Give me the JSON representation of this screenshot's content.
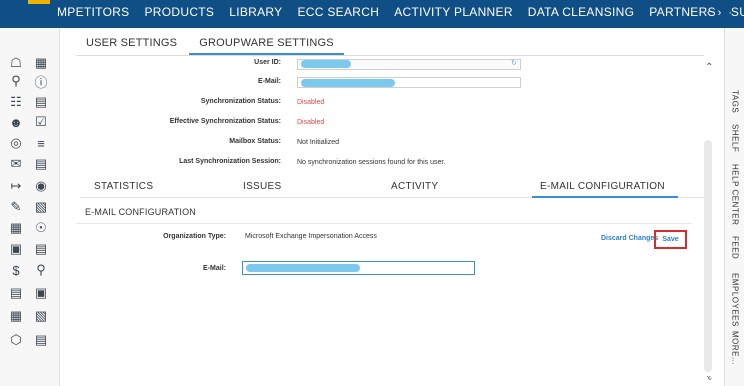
{
  "nav": {
    "items": [
      "MPETITORS",
      "PRODUCTS",
      "LIBRARY",
      "ECC SEARCH",
      "ACTIVITY PLANNER",
      "DATA CLEANSING",
      "PARTNERS",
      "SURVE"
    ],
    "arrows": "‹ › ·"
  },
  "tabs": [
    "USER SETTINGS",
    "GROUPWARE SETTINGS"
  ],
  "settings": {
    "user_id_label": "User ID:",
    "email_label": "E-Mail:",
    "sync_status_label": "Synchronization Status:",
    "sync_status_value": "Disabled",
    "eff_sync_status_label": "Effective Synchronization Status:",
    "eff_sync_status_value": "Disabled",
    "mailbox_status_label": "Mailbox Status:",
    "mailbox_status_value": "Not Initialized",
    "last_sync_label": "Last Synchronization Session:",
    "last_sync_value": "No synchronization sessions found for this user."
  },
  "subtabs": [
    "STATISTICS",
    "ISSUES",
    "ACTIVITY",
    "E-MAIL CONFIGURATION"
  ],
  "config": {
    "title": "E-MAIL CONFIGURATION",
    "discard_label": "Discard Changes",
    "save_label": "Save",
    "org_type_label": "Organization Type:",
    "org_type_value": "Microsoft Exchange Impersonation Access",
    "email_label": "E-Mail:"
  },
  "right_tabs": [
    "TAGS",
    "SHELF",
    "HELP CENTER",
    "FEED",
    "EMPLOYEES",
    "MORE..."
  ],
  "colors": {
    "brand": "#0f4f86",
    "accent": "#3a8ed1",
    "status_red": "#e34a4a",
    "highlight": "#d42d2d"
  },
  "left_icons": [
    "home-icon",
    "calendar-icon",
    "search-icon",
    "alert-icon",
    "org-chart-icon",
    "box-icon",
    "user-icon",
    "checklist-icon",
    "contact-icon",
    "list-icon",
    "mail-icon",
    "checkbox-list-icon",
    "money-arrow-icon",
    "coin-icon",
    "edit-icon",
    "document-edit-icon",
    "building-icon",
    "globe-icon",
    "chat-icon",
    "clipboard-icon",
    "dollar-doc-icon",
    "map-pin-icon",
    "list-doc-icon",
    "briefcase-icon",
    "table-icon",
    "clipboard-list-icon",
    "cube-icon",
    "columns-icon"
  ]
}
